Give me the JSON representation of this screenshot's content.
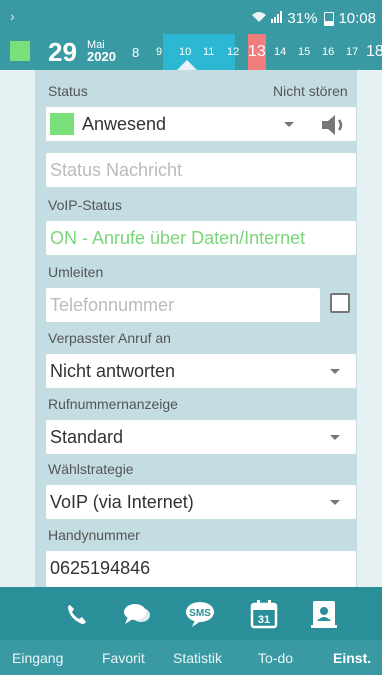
{
  "statusbar": {
    "left_icon": "chevron-right-icon",
    "right_text": "31%",
    "time": "10:08"
  },
  "timeline": {
    "day": "29",
    "month": "Mai",
    "year": "2020",
    "hours": [
      "8",
      "9",
      "10",
      "11",
      "12",
      "13",
      "14",
      "15",
      "16",
      "17",
      "18"
    ],
    "colors": {
      "green": "#7be07b",
      "blue": "#2cb8d3",
      "red": "#f07c7c"
    }
  },
  "form": {
    "status_label": "Status",
    "dnd_label": "Nicht stören",
    "status_value": "Anwesend",
    "status_message_placeholder": "Status Nachricht",
    "voip_label": "VoIP-Status",
    "voip_value": "ON - Anrufe über Daten/Internet",
    "forward_label": "Umleiten",
    "phone_placeholder": "Telefonnummer",
    "missed_label": "Verpasster Anruf an",
    "missed_value": "Nicht antworten",
    "callerid_label": "Rufnummernanzeige",
    "callerid_value": "Standard",
    "dial_label": "Wählstrategie",
    "dial_value": "VoIP (via Internet)",
    "mobile_label": "Handynummer",
    "mobile_value": "0625194846"
  },
  "tabbar": {
    "icons": [
      "phone-icon",
      "chat-icon",
      "sms-icon",
      "calendar-icon",
      "contacts-icon"
    ],
    "calendar_day": "31",
    "sms_text": "SMS",
    "labels": [
      "Eingang",
      "Favorit",
      "Statistik",
      "To-do",
      "Einst."
    ]
  }
}
